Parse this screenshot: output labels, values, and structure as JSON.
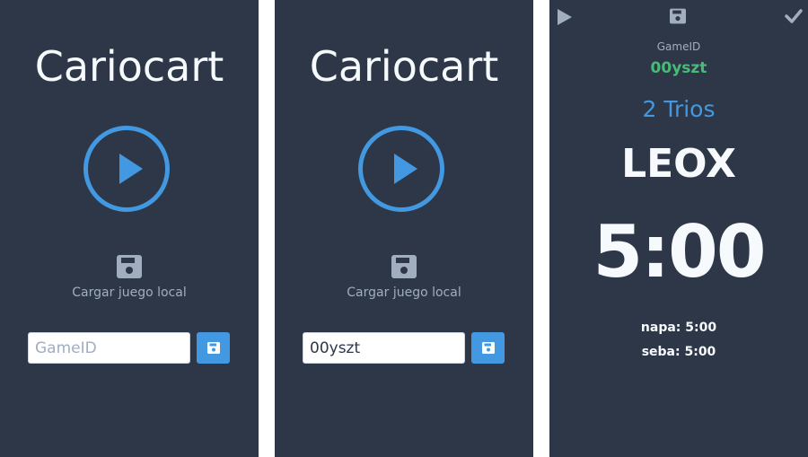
{
  "colors": {
    "background": "#2d3748",
    "accent": "#4299e1",
    "muted": "#a0aec0",
    "success": "#48bb78",
    "text": "#f7fafc"
  },
  "screen1": {
    "title": "Cariocart",
    "play_icon": "play-circle-icon",
    "save_icon": "floppy-disk-icon",
    "load_local_label": "Cargar juego local",
    "gameid_input": {
      "value": "",
      "placeholder": "GameID"
    },
    "save_button_icon": "floppy-disk-icon"
  },
  "screen2": {
    "title": "Cariocart",
    "play_icon": "play-circle-icon",
    "save_icon": "floppy-disk-icon",
    "load_local_label": "Cargar juego local",
    "gameid_input": {
      "value": "00yszt",
      "placeholder": "GameID"
    },
    "save_button_icon": "floppy-disk-icon"
  },
  "screen3": {
    "toolbar": {
      "play_icon": "play-icon",
      "save_icon": "floppy-disk-icon",
      "check_icon": "check-icon"
    },
    "gameid_caption": "GameID",
    "gameid_value": "00yszt",
    "mode": "2 Trios",
    "current_player": "LEOX",
    "timer": "5:00",
    "players": [
      {
        "label": "napa: 5:00"
      },
      {
        "label": "seba: 5:00"
      }
    ]
  }
}
